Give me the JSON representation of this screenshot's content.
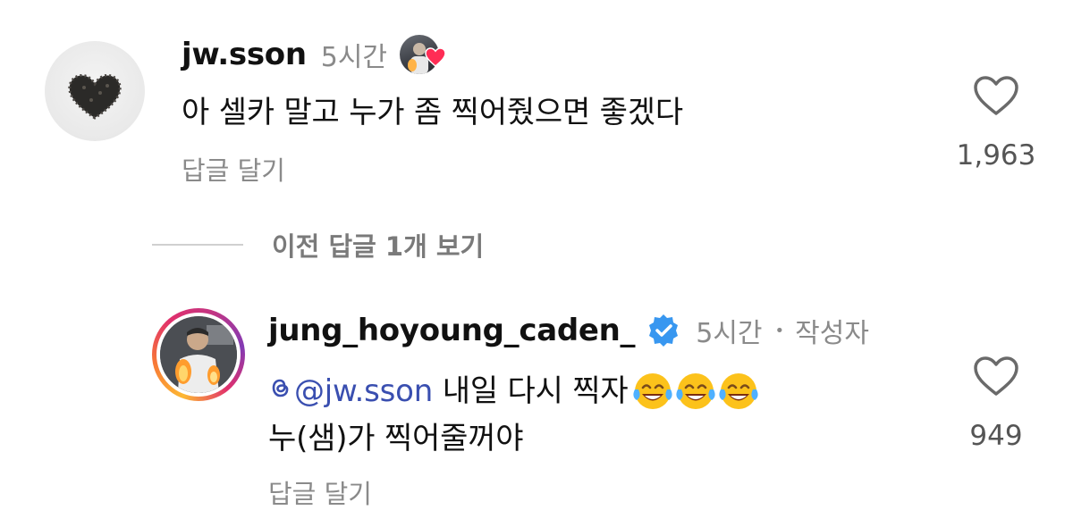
{
  "comments": [
    {
      "username": "jw.sson",
      "time": "5시간",
      "text": "아 셀카 말고 누가 좀 찍어줬으면 좋겠다",
      "reply_label": "답글 달기",
      "likes": "1,963",
      "icons": {
        "like": "heart-outline-icon",
        "liked_by_author": "red-heart-icon"
      },
      "colors": {
        "heart_badge": "#ff2d55"
      }
    },
    {
      "username": "jung_hoyoung_caden_",
      "verified": true,
      "time": "5시간",
      "separator": "•",
      "author_tag": "작성자",
      "mention": "@jw.sson",
      "text_after_mention": " 내일 다시 찍자",
      "emojis": [
        "face-with-tears-of-joy-icon",
        "face-with-tears-of-joy-icon",
        "face-with-tears-of-joy-icon"
      ],
      "text_line2": "누(샘)가 찍어줄꺼야",
      "reply_label": "답글 달기",
      "likes": "949",
      "colors": {
        "mention": "#3a4fb0",
        "verified_badge": "#3897f0"
      }
    }
  ],
  "view_previous": {
    "label": "이전 답글 1개 보기"
  }
}
